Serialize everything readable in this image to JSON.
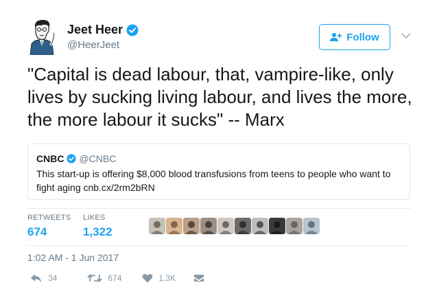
{
  "user": {
    "name": "Jeet Heer",
    "handle": "@HeerJeet"
  },
  "follow_label": "Follow",
  "tweet_text": "\"Capital is dead labour, that, vampire-like, only lives by sucking living labour, and lives the more, the more labour it sucks\" -- Marx",
  "quoted": {
    "name": "CNBC",
    "handle": "@CNBC",
    "text": "This start-up is offering $8,000 blood transfusions from teens to people who want to fight aging  cnb.cx/2rm2bRN"
  },
  "stats": {
    "retweets_label": "RETWEETS",
    "retweets_value": "674",
    "likes_label": "LIKES",
    "likes_value": "1,322"
  },
  "liker_avatar_count": 10,
  "timestamp": "1:02 AM - 1 Jun 2017",
  "actions": {
    "reply_count": "34",
    "retweet_count": "674",
    "like_count": "1.3K"
  },
  "colors": {
    "accent": "#1da1f2",
    "secondary_text": "#657786",
    "border": "#e1e8ed"
  }
}
